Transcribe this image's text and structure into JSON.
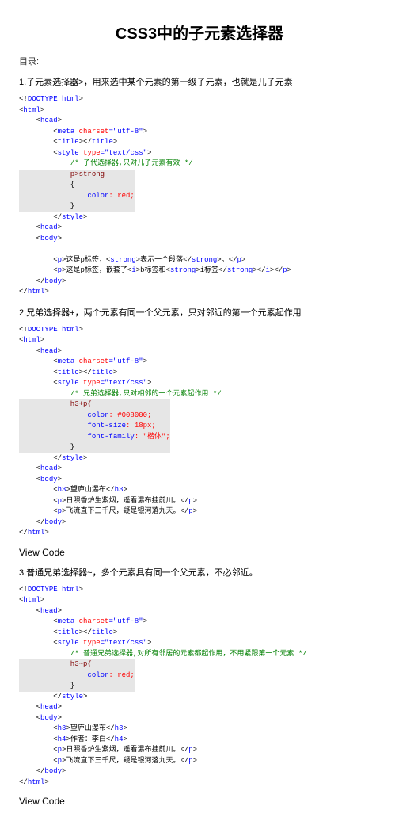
{
  "title": "CSS3中的子元素选择器",
  "toc_label": "目录:",
  "sections": {
    "s1": "1.子元素选择器>，用来选中某个元素的第一级子元素，也就是儿子元素",
    "s2": "2.兄弟选择器+，两个元素有同一个父元素，只对邻近的第一个元素起作用",
    "s3": "3.普通兄弟选择器~，多个元素具有同一个父元素，不必邻近。"
  },
  "view_code": "View Code",
  "code1": {
    "doctype_open": "<!",
    "doctype": "DOCTYPE html",
    "doctype_close": ">",
    "html_o": "html",
    "head_o": "head",
    "meta": "meta",
    "charset_a": " charset",
    "charset_v": "=\"utf-8\"",
    "title_o": "title",
    "title_c": "title",
    "style_o": "style",
    "type_a": " type",
    "type_v": "=\"text/css\"",
    "cmt": "/* 子代选择器,只对儿子元素有效 */",
    "sel1": "            p>strong",
    "brace_o": "            {",
    "color_k": "                color",
    "color_v": ": red;",
    "brace_c": "            }",
    "p_text1": "<p>这是p标签，<strong>表示一个段落</strong>。</p>",
    "p_text2": "<p>这是p标签，嵌套了<i>b标签和<strong>i标签</strong></i></p>",
    "body_o": "body",
    "body_c": "body",
    "html_c": "html"
  },
  "code2": {
    "cmt": "/* 兄弟选择器,只对相邻的一个元素起作用 */",
    "sel": "            h3+p{",
    "color_k": "                color",
    "color_v": ": #008000;",
    "fs_k": "                font-size",
    "fs_v": ": 18px;",
    "ff_k": "                font-family",
    "ff_v": ": \"楷体\";",
    "brace_c": "            }",
    "h3_text": "望庐山瀑布",
    "p1": "日照香炉生紫烟，遥看瀑布挂前川。",
    "p2": "飞流直下三千尺，疑是银河落九天。"
  },
  "code3": {
    "cmt": "/* 普通兄弟选择器,对所有邻居的元素都起作用，不用紧跟第一个元素 */",
    "sel": "            h3~p{",
    "color_k": "                color",
    "color_v": ": red;",
    "brace_c": "            }",
    "h3_text": "望庐山瀑布",
    "h4_text": "作者：李白",
    "p1": "日照香炉生紫烟，遥看瀑布挂前川。",
    "p2": "飞流直下三千尺，疑是银河落九天。"
  }
}
